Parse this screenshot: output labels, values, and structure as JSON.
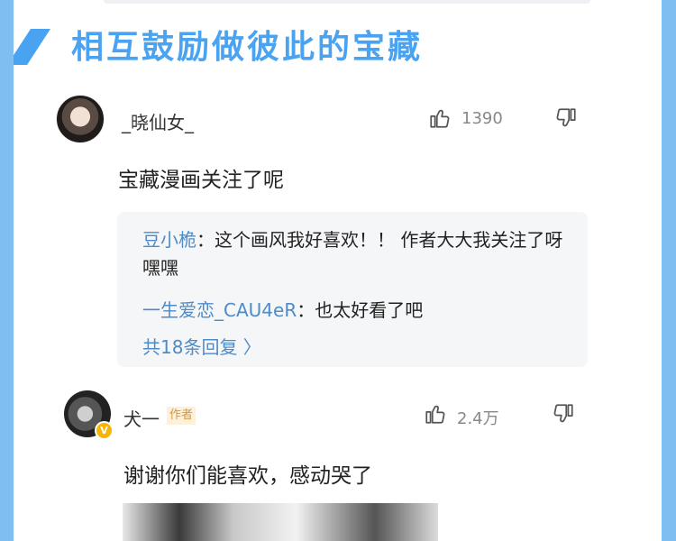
{
  "section": {
    "title": "相互鼓励做彼此的宝藏"
  },
  "comments": [
    {
      "username": "_晓仙女_",
      "likes": "1390",
      "text": "宝藏漫画关注了呢",
      "replies": [
        {
          "user": "豆小桅",
          "sep": "：",
          "text": "这个画风我好喜欢！！ 作者大大我关注了呀嘿嘿"
        },
        {
          "user": "一生爱恋_CAU4eR",
          "sep": "：",
          "text": "也太好看了吧"
        }
      ],
      "more_replies": "共18条回复 〉"
    },
    {
      "username": "犬一",
      "badge": "作者",
      "verified": "V",
      "likes": "2.4万",
      "text": "谢谢你们能喜欢，感动哭了"
    }
  ],
  "icons": {
    "like": "thumbs-up-icon",
    "dislike": "thumbs-down-icon"
  },
  "colors": {
    "background": "#7fbef0",
    "accent": "#4aa3f0",
    "link": "#4e8bc8",
    "badge": "#d39845"
  }
}
